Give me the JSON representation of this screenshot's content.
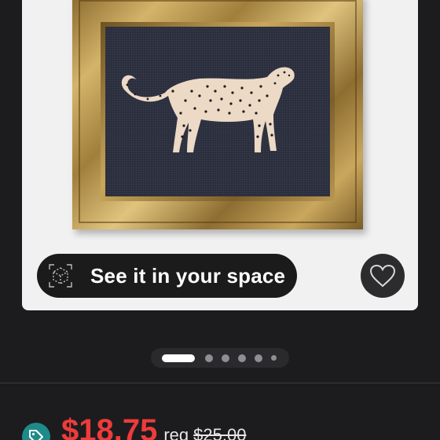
{
  "product": {
    "image_alt": "Framed leopard wall art",
    "ar_button_label": "See it in your space"
  },
  "gallery": {
    "total_images": 6,
    "active_index": 0
  },
  "pricing": {
    "current_price": "$18.75",
    "regular_label": "reg",
    "regular_price": "$25.00"
  },
  "colors": {
    "background": "#1c1c1e",
    "sale_price": "#ee3b3b",
    "tag_icon": "#1f8a8a",
    "card": "#f1f1f1"
  },
  "icons": {
    "ar": "ar-cube-icon",
    "favorite": "heart-icon",
    "price_tag": "price-tag-icon"
  }
}
